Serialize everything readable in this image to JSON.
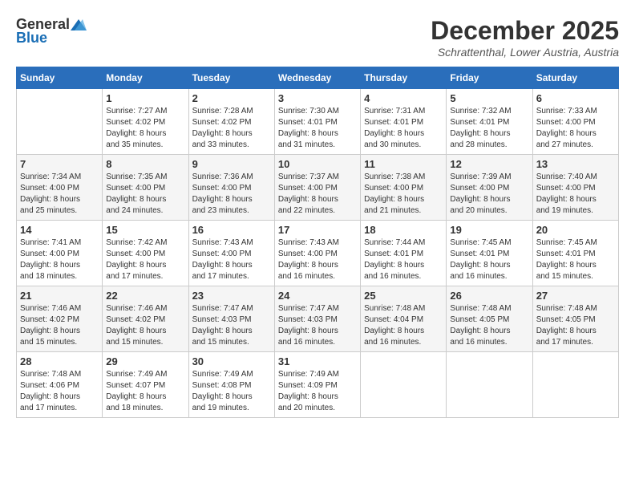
{
  "logo": {
    "general": "General",
    "blue": "Blue"
  },
  "header": {
    "month": "December 2025",
    "location": "Schrattenthal, Lower Austria, Austria"
  },
  "weekdays": [
    "Sunday",
    "Monday",
    "Tuesday",
    "Wednesday",
    "Thursday",
    "Friday",
    "Saturday"
  ],
  "weeks": [
    [
      {
        "day": "",
        "info": ""
      },
      {
        "day": "1",
        "info": "Sunrise: 7:27 AM\nSunset: 4:02 PM\nDaylight: 8 hours\nand 35 minutes."
      },
      {
        "day": "2",
        "info": "Sunrise: 7:28 AM\nSunset: 4:02 PM\nDaylight: 8 hours\nand 33 minutes."
      },
      {
        "day": "3",
        "info": "Sunrise: 7:30 AM\nSunset: 4:01 PM\nDaylight: 8 hours\nand 31 minutes."
      },
      {
        "day": "4",
        "info": "Sunrise: 7:31 AM\nSunset: 4:01 PM\nDaylight: 8 hours\nand 30 minutes."
      },
      {
        "day": "5",
        "info": "Sunrise: 7:32 AM\nSunset: 4:01 PM\nDaylight: 8 hours\nand 28 minutes."
      },
      {
        "day": "6",
        "info": "Sunrise: 7:33 AM\nSunset: 4:00 PM\nDaylight: 8 hours\nand 27 minutes."
      }
    ],
    [
      {
        "day": "7",
        "info": "Sunrise: 7:34 AM\nSunset: 4:00 PM\nDaylight: 8 hours\nand 25 minutes."
      },
      {
        "day": "8",
        "info": "Sunrise: 7:35 AM\nSunset: 4:00 PM\nDaylight: 8 hours\nand 24 minutes."
      },
      {
        "day": "9",
        "info": "Sunrise: 7:36 AM\nSunset: 4:00 PM\nDaylight: 8 hours\nand 23 minutes."
      },
      {
        "day": "10",
        "info": "Sunrise: 7:37 AM\nSunset: 4:00 PM\nDaylight: 8 hours\nand 22 minutes."
      },
      {
        "day": "11",
        "info": "Sunrise: 7:38 AM\nSunset: 4:00 PM\nDaylight: 8 hours\nand 21 minutes."
      },
      {
        "day": "12",
        "info": "Sunrise: 7:39 AM\nSunset: 4:00 PM\nDaylight: 8 hours\nand 20 minutes."
      },
      {
        "day": "13",
        "info": "Sunrise: 7:40 AM\nSunset: 4:00 PM\nDaylight: 8 hours\nand 19 minutes."
      }
    ],
    [
      {
        "day": "14",
        "info": "Sunrise: 7:41 AM\nSunset: 4:00 PM\nDaylight: 8 hours\nand 18 minutes."
      },
      {
        "day": "15",
        "info": "Sunrise: 7:42 AM\nSunset: 4:00 PM\nDaylight: 8 hours\nand 17 minutes."
      },
      {
        "day": "16",
        "info": "Sunrise: 7:43 AM\nSunset: 4:00 PM\nDaylight: 8 hours\nand 17 minutes."
      },
      {
        "day": "17",
        "info": "Sunrise: 7:43 AM\nSunset: 4:00 PM\nDaylight: 8 hours\nand 16 minutes."
      },
      {
        "day": "18",
        "info": "Sunrise: 7:44 AM\nSunset: 4:01 PM\nDaylight: 8 hours\nand 16 minutes."
      },
      {
        "day": "19",
        "info": "Sunrise: 7:45 AM\nSunset: 4:01 PM\nDaylight: 8 hours\nand 16 minutes."
      },
      {
        "day": "20",
        "info": "Sunrise: 7:45 AM\nSunset: 4:01 PM\nDaylight: 8 hours\nand 15 minutes."
      }
    ],
    [
      {
        "day": "21",
        "info": "Sunrise: 7:46 AM\nSunset: 4:02 PM\nDaylight: 8 hours\nand 15 minutes."
      },
      {
        "day": "22",
        "info": "Sunrise: 7:46 AM\nSunset: 4:02 PM\nDaylight: 8 hours\nand 15 minutes."
      },
      {
        "day": "23",
        "info": "Sunrise: 7:47 AM\nSunset: 4:03 PM\nDaylight: 8 hours\nand 15 minutes."
      },
      {
        "day": "24",
        "info": "Sunrise: 7:47 AM\nSunset: 4:03 PM\nDaylight: 8 hours\nand 16 minutes."
      },
      {
        "day": "25",
        "info": "Sunrise: 7:48 AM\nSunset: 4:04 PM\nDaylight: 8 hours\nand 16 minutes."
      },
      {
        "day": "26",
        "info": "Sunrise: 7:48 AM\nSunset: 4:05 PM\nDaylight: 8 hours\nand 16 minutes."
      },
      {
        "day": "27",
        "info": "Sunrise: 7:48 AM\nSunset: 4:05 PM\nDaylight: 8 hours\nand 17 minutes."
      }
    ],
    [
      {
        "day": "28",
        "info": "Sunrise: 7:48 AM\nSunset: 4:06 PM\nDaylight: 8 hours\nand 17 minutes."
      },
      {
        "day": "29",
        "info": "Sunrise: 7:49 AM\nSunset: 4:07 PM\nDaylight: 8 hours\nand 18 minutes."
      },
      {
        "day": "30",
        "info": "Sunrise: 7:49 AM\nSunset: 4:08 PM\nDaylight: 8 hours\nand 19 minutes."
      },
      {
        "day": "31",
        "info": "Sunrise: 7:49 AM\nSunset: 4:09 PM\nDaylight: 8 hours\nand 20 minutes."
      },
      {
        "day": "",
        "info": ""
      },
      {
        "day": "",
        "info": ""
      },
      {
        "day": "",
        "info": ""
      }
    ]
  ]
}
